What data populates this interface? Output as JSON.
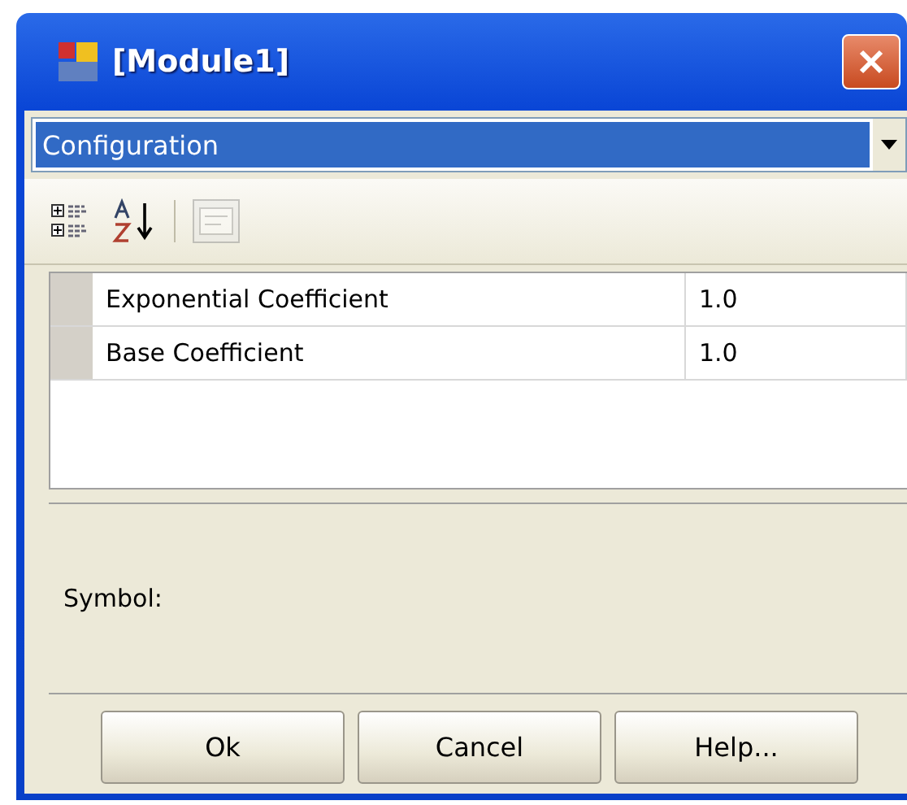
{
  "window": {
    "title": "[Module1]"
  },
  "category_dropdown": {
    "value": "Configuration",
    "selected": true
  },
  "toolbar": [
    {
      "kind": "categorized",
      "disabled": false
    },
    {
      "kind": "alphabetical",
      "disabled": false
    },
    {
      "kind": "pages",
      "disabled": true
    }
  ],
  "properties": [
    {
      "name": "Exponential Coefficient",
      "value": "1.0"
    },
    {
      "name": "Base Coefficient",
      "value": "1.0"
    }
  ],
  "description": {
    "title": "Symbol:"
  },
  "buttons": [
    "Ok",
    "Cancel",
    "Help..."
  ]
}
